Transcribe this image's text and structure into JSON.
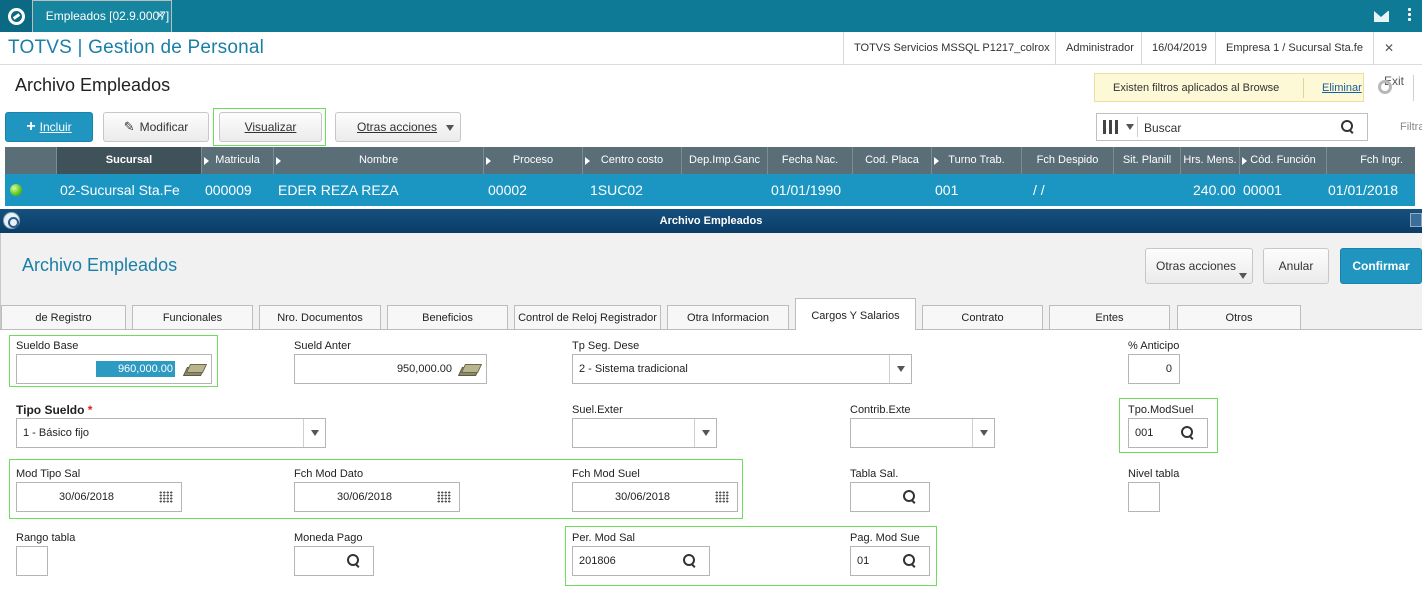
{
  "tab": {
    "label": "Empleados [02.9.0007]",
    "close": "✕"
  },
  "header": {
    "app_title": "TOTVS | Gestion de Personal",
    "server": "TOTVS Servicios MSSQL P1217_colrox",
    "user": "Administrador",
    "date": "16/04/2019",
    "company": "Empresa 1 / Sucursal Sta.fe",
    "exit": "✕  Exit"
  },
  "browse": {
    "title": "Archivo Empleados",
    "filter_notice": "Existen filtros aplicados al Browse",
    "filter_remove": "Eliminar",
    "buttons": {
      "incluir": "Incluir",
      "modificar": "Modificar",
      "visualizar": "Visualizar",
      "otras": "Otras acciones"
    },
    "search_placeholder": "Buscar",
    "filtrar": "Filtra",
    "columns": [
      "Sucursal",
      "Matricula",
      "Nombre",
      "Proceso",
      "Centro costo",
      "Dep.Imp.Ganc",
      "Fecha Nac.",
      "Cod. Placa",
      "Turno Trab.",
      "Fch Despido",
      "Sit. Planill",
      "Hrs. Mens.",
      "Cód. Función",
      "Fch Ingr."
    ],
    "row": {
      "sucursal": "02-Sucursal Sta.Fe",
      "matricula": "000009",
      "nombre": "EDER  REZA REZA",
      "proceso": "00002",
      "centro_costo": "1SUC02",
      "fecha_nac": "01/01/1990",
      "turno": "001",
      "fch_despido": "/  /",
      "hrs_mens": "240.00",
      "cod_funcion": "00001",
      "fch_ingr": "01/01/2018"
    }
  },
  "modal": {
    "window_title": "Archivo Empleados",
    "title": "Archivo Empleados",
    "buttons": {
      "otras": "Otras acciones",
      "anular": "Anular",
      "confirmar": "Confirmar"
    },
    "tabs": [
      "de Registro",
      "Funcionales",
      "Nro. Documentos",
      "Beneficios",
      "Control de Reloj Registrador",
      "Otra Informacion",
      "Cargos Y Salarios",
      "Contrato",
      "Entes",
      "Otros"
    ],
    "active_tab": "Cargos Y Salarios",
    "fields": {
      "sueldo_base": {
        "label": "Sueldo Base",
        "value": "960,000.00"
      },
      "sueld_anter": {
        "label": "Sueld Anter",
        "value": "950,000.00"
      },
      "tp_seg_dese": {
        "label": "Tp Seg. Dese",
        "value": "2 - Sistema tradicional"
      },
      "anticipo": {
        "label": "% Anticipo",
        "value": "0"
      },
      "tipo_sueldo": {
        "label": "Tipo Sueldo",
        "required": "*",
        "value": "1 - Básico fijo"
      },
      "suel_exter": {
        "label": "Suel.Exter",
        "value": ""
      },
      "contrib_exte": {
        "label": "Contrib.Exte",
        "value": ""
      },
      "tpo_modsuel": {
        "label": "Tpo.ModSuel",
        "value": "001"
      },
      "mod_tipo_sal": {
        "label": "Mod Tipo Sal",
        "value": "30/06/2018"
      },
      "fch_mod_dato": {
        "label": "Fch Mod Dato",
        "value": "30/06/2018"
      },
      "fch_mod_suel": {
        "label": "Fch Mod Suel",
        "value": "30/06/2018"
      },
      "tabla_sal": {
        "label": "Tabla Sal.",
        "value": ""
      },
      "nivel_tabla": {
        "label": "Nivel tabla",
        "value": ""
      },
      "rango_tabla": {
        "label": "Rango tabla",
        "value": ""
      },
      "moneda_pago": {
        "label": "Moneda Pago",
        "value": ""
      },
      "per_mod_sal": {
        "label": "Per. Mod Sal",
        "value": "201806"
      },
      "pag_mod_sue": {
        "label": "Pag. Mod Sue",
        "value": "01"
      }
    }
  },
  "colors": {
    "topbar": "#0f7a96",
    "accent": "#1a7fa8",
    "row_selected": "#1b96c3",
    "grid_header": "#5a6e77",
    "highlight_box": "#6cdc5a"
  }
}
